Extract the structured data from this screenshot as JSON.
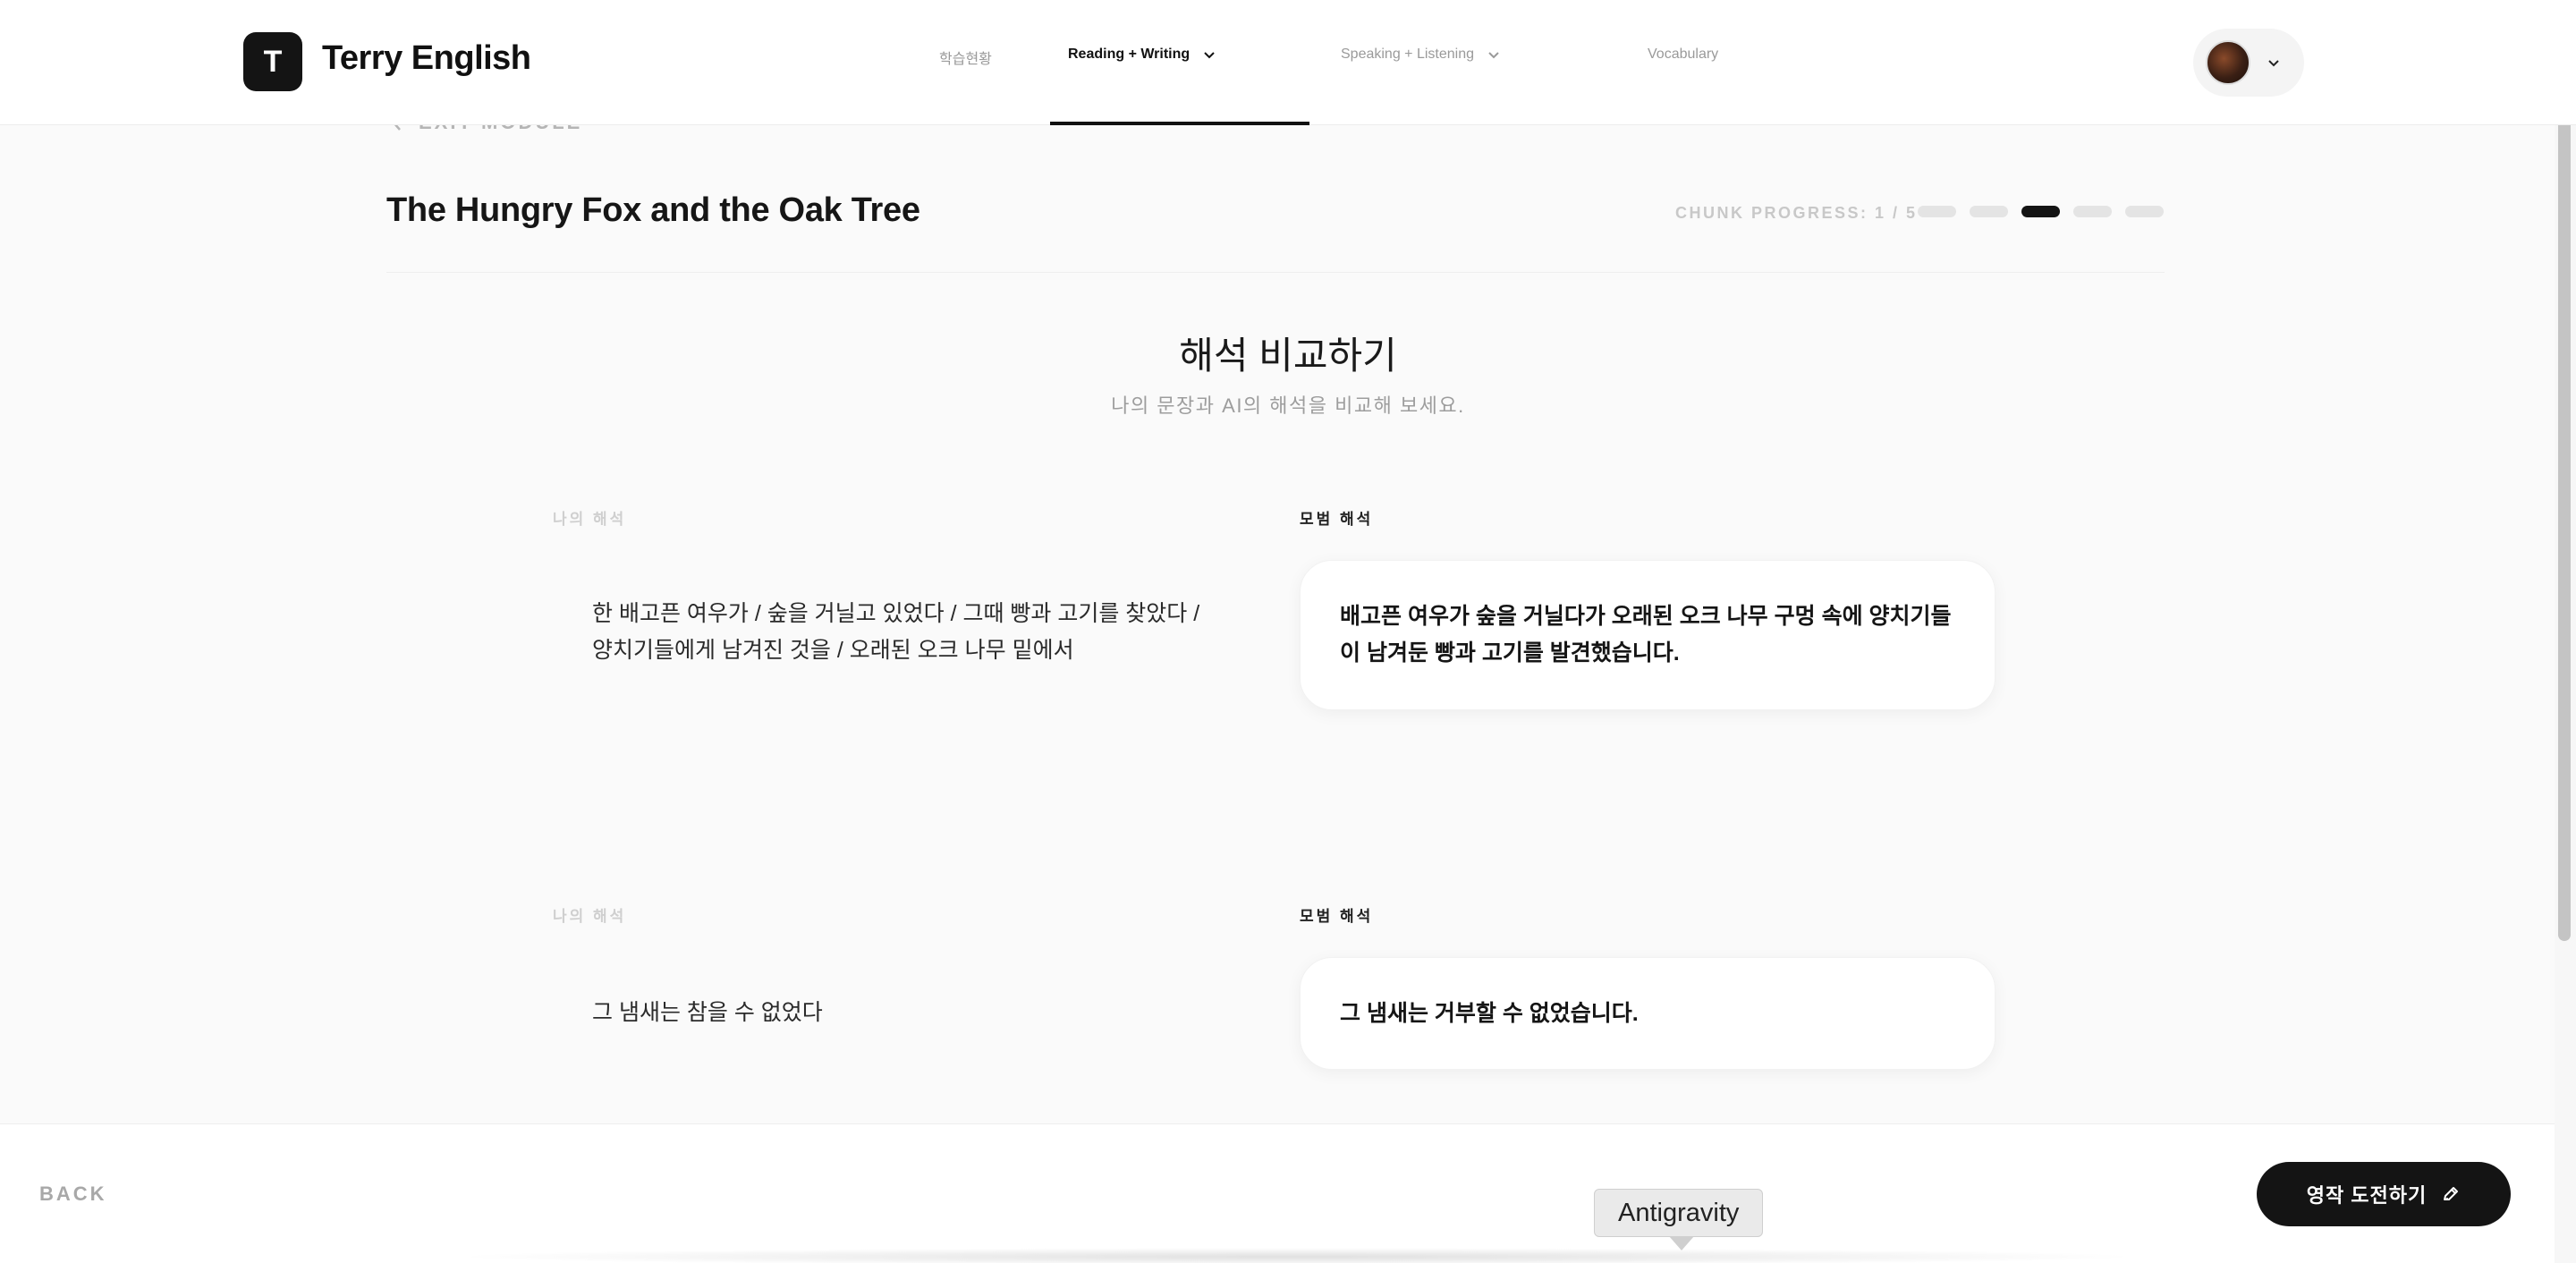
{
  "header": {
    "logo_letter": "T",
    "brand": "Terry English",
    "nav": [
      {
        "label": "학습현황",
        "active": false
      },
      {
        "label": "Reading + Writing",
        "active": true
      },
      {
        "label": "Speaking + Listening",
        "active": false
      },
      {
        "label": "Vocabulary",
        "active": false
      }
    ]
  },
  "module": {
    "exit_label": "EXIT MODULE",
    "title": "The Hungry Fox and the Oak Tree",
    "chunk_progress_label": "CHUNK PROGRESS: 1 / 5",
    "chunk_total": 5,
    "chunk_active_index": 2
  },
  "section": {
    "title": "해석 비교하기",
    "subtitle": "나의 문장과 AI의 해석을 비교해 보세요."
  },
  "comparisons": [
    {
      "mine_label": "나의 해석",
      "model_label": "모범 해석",
      "mine_text": "한 배고픈 여우가 / 숲을 거닐고 있었다 / 그때 빵과 고기를 찾았다 / 양치기들에게 남겨진 것을 / 오래된 오크 나무 밑에서",
      "model_text": "배고픈 여우가 숲을 거닐다가 오래된 오크 나무 구멍 속에 양치기들이 남겨둔 빵과 고기를 발견했습니다."
    },
    {
      "mine_label": "나의 해석",
      "model_label": "모범 해석",
      "mine_text": "그 냄새는 참을 수 없었다",
      "model_text": "그 냄새는 거부할 수 없었습니다."
    }
  ],
  "footer": {
    "back_label": "BACK",
    "challenge_label": "영작 도전하기",
    "tooltip": "Antigravity"
  }
}
